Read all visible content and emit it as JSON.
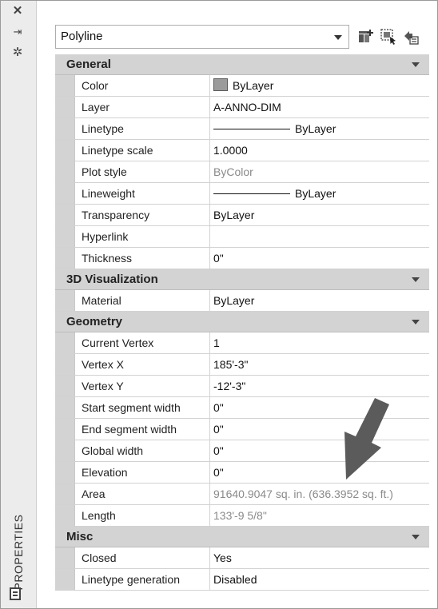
{
  "sidebar": {
    "title": "PROPERTIES",
    "icons": [
      "close-icon",
      "pin-icon",
      "settings-icon",
      "properties-panel-icon"
    ]
  },
  "selector": {
    "value": "Polyline",
    "tools": [
      "add-selected-icon",
      "select-objects-icon",
      "quick-select-icon"
    ]
  },
  "sections": [
    {
      "title": "General",
      "rows": [
        {
          "label": "Color",
          "value": "ByLayer",
          "kind": "swatch"
        },
        {
          "label": "Layer",
          "value": "A-ANNO-DIM"
        },
        {
          "label": "Linetype",
          "value": "ByLayer",
          "kind": "linetype"
        },
        {
          "label": "Linetype scale",
          "value": "1.0000"
        },
        {
          "label": "Plot style",
          "value": "ByColor",
          "dim": true
        },
        {
          "label": "Lineweight",
          "value": "ByLayer",
          "kind": "linetype"
        },
        {
          "label": "Transparency",
          "value": "ByLayer"
        },
        {
          "label": "Hyperlink",
          "value": ""
        },
        {
          "label": "Thickness",
          "value": "0\""
        }
      ]
    },
    {
      "title": "3D Visualization",
      "rows": [
        {
          "label": "Material",
          "value": "ByLayer"
        }
      ]
    },
    {
      "title": "Geometry",
      "rows": [
        {
          "label": "Current Vertex",
          "value": "1"
        },
        {
          "label": "Vertex X",
          "value": "185'-3\""
        },
        {
          "label": "Vertex Y",
          "value": "-12'-3\""
        },
        {
          "label": "Start segment width",
          "value": "0\""
        },
        {
          "label": "End segment width",
          "value": "0\""
        },
        {
          "label": "Global width",
          "value": "0\""
        },
        {
          "label": "Elevation",
          "value": "0\""
        },
        {
          "label": "Area",
          "value": "91640.9047 sq. in. (636.3952 sq. ft.)",
          "dim": true
        },
        {
          "label": "Length",
          "value": "133'-9 5/8\"",
          "dim": true
        }
      ]
    },
    {
      "title": "Misc",
      "rows": [
        {
          "label": "Closed",
          "value": "Yes"
        },
        {
          "label": "Linetype generation",
          "value": "Disabled"
        }
      ]
    }
  ]
}
